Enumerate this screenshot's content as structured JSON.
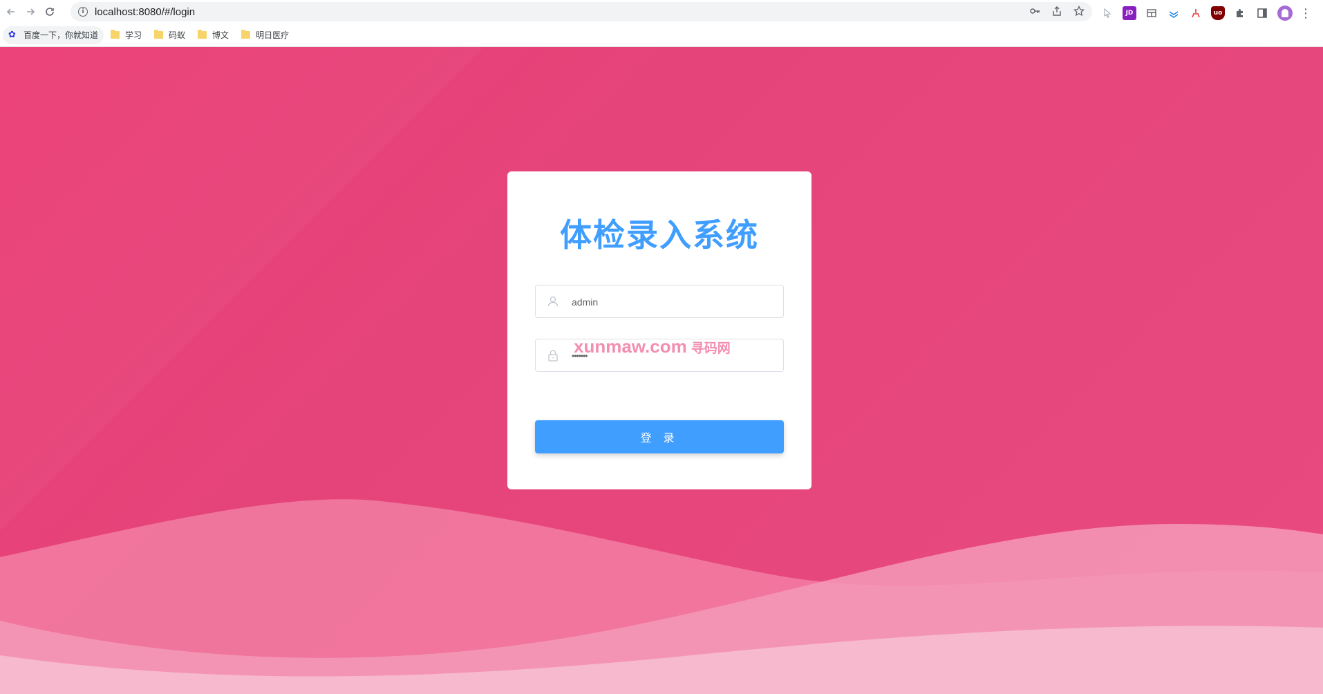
{
  "browser": {
    "url": "localhost:8080/#/login",
    "bookmarks": [
      {
        "label": "百度一下，你就知道",
        "icon": "baidu-icon"
      },
      {
        "label": "学习",
        "icon": "folder-icon"
      },
      {
        "label": "码蚁",
        "icon": "folder-icon"
      },
      {
        "label": "博文",
        "icon": "folder-icon"
      },
      {
        "label": "明日医疗",
        "icon": "folder-icon"
      }
    ],
    "extensions": [
      "cursor-ext-icon",
      "jd-ext-icon",
      "store-ext-icon",
      "layers-ext-icon",
      "red-ext-icon",
      "ublock-ext-icon",
      "puzzle-icon",
      "sidepanel-icon"
    ]
  },
  "login": {
    "title": "体检录入系统",
    "username_value": "admin",
    "password_value": "•••••••",
    "submit_label": "登 录",
    "watermark": "xunmaw.com",
    "watermark_cn": "寻码网"
  },
  "colors": {
    "background": "#e8457c",
    "primary": "#409eff",
    "card": "#ffffff"
  }
}
